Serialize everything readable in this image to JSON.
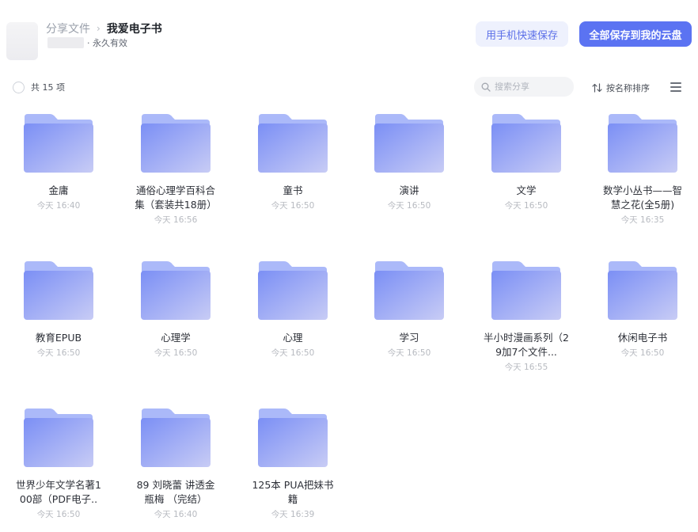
{
  "header": {
    "breadcrumb_parent": "分享文件",
    "breadcrumb_sep": "›",
    "title": "我爱电子书",
    "validity": "· 永久有效",
    "btn_mobile": "用手机快速保存",
    "btn_save_all": "全部保存到我的云盘"
  },
  "toolbar": {
    "count_label": "共 15 项",
    "search_placeholder": "搜索分享",
    "sort_label": "按名称排序"
  },
  "colors": {
    "accent": "#5b73f2",
    "folder_top": "#8fa2f7",
    "folder_front_from": "#7b8ff5",
    "folder_front_to": "#c8ccf5"
  },
  "items": [
    {
      "name": "金庸",
      "time": "今天 16:40"
    },
    {
      "name": "通俗心理学百科合集（套装共18册）",
      "time": "今天 16:56"
    },
    {
      "name": "童书",
      "time": "今天 16:50"
    },
    {
      "name": "演讲",
      "time": "今天 16:50"
    },
    {
      "name": "文学",
      "time": "今天 16:50"
    },
    {
      "name": "数学小丛书——智慧之花(全5册)",
      "time": "今天 16:35"
    },
    {
      "name": "教育EPUB",
      "time": "今天 16:50"
    },
    {
      "name": "心理学",
      "time": "今天 16:50"
    },
    {
      "name": "心理",
      "time": "今天 16:50"
    },
    {
      "name": "学习",
      "time": "今天 16:50"
    },
    {
      "name": "半小时漫画系列（29加7个文件...",
      "time": "今天 16:55"
    },
    {
      "name": "休闲电子书",
      "time": "今天 16:50"
    },
    {
      "name": "世界少年文学名著100部（PDF电子..",
      "time": "今天 16:50"
    },
    {
      "name": "89 刘晓蕾 讲透金瓶梅 （完结）",
      "time": "今天 16:40"
    },
    {
      "name": "125本 PUA把妹书籍",
      "time": "今天 16:39"
    }
  ]
}
